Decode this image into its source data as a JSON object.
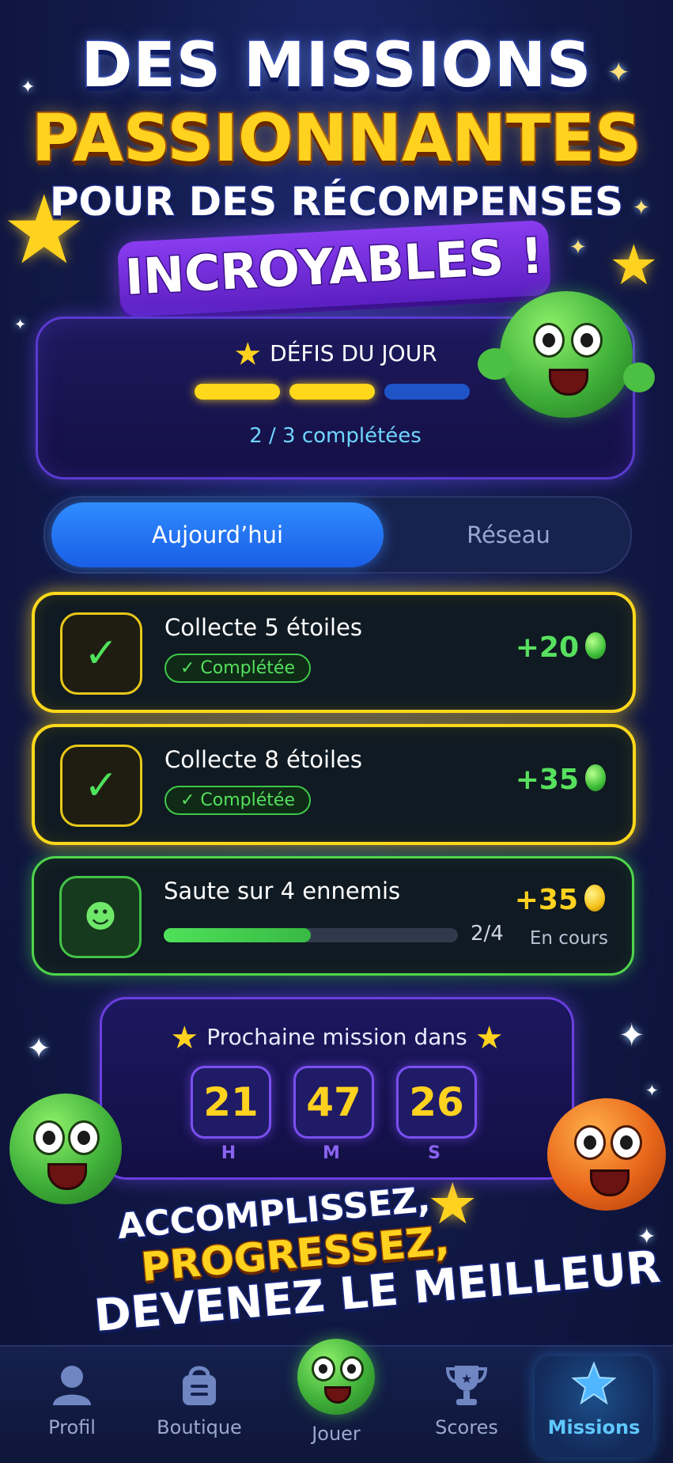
{
  "hero": {
    "line1": "DES MISSIONS",
    "line2": "PASSIONNANTES",
    "line3": "POUR DES RÉCOMPENSES",
    "line4": "INCROYABLES !"
  },
  "daily": {
    "title": "DÉFIS DU JOUR",
    "completed": 2,
    "total": 3,
    "count_label": "2 / 3 complétées"
  },
  "tabs": [
    {
      "label": "Aujourd’hui",
      "active": true
    },
    {
      "label": "Réseau",
      "active": false
    }
  ],
  "missions": [
    {
      "title": "Collecte 5 étoiles",
      "badge": "✓ Complétée",
      "reward": "+20",
      "status": "completed"
    },
    {
      "title": "Collecte 8 étoiles",
      "badge": "✓ Complétée",
      "reward": "+35",
      "status": "completed"
    },
    {
      "title": "Saute sur 4 ennemis",
      "progress_label": "2/4",
      "progress": 0.5,
      "reward": "+35",
      "status_text": "En cours"
    }
  ],
  "countdown": {
    "title": "Prochaine mission dans",
    "hours": "21",
    "minutes": "47",
    "seconds": "26",
    "h_label": "H",
    "m_label": "M",
    "s_label": "S"
  },
  "slogan": {
    "line1": "ACCOMPLISSEZ,",
    "line2": "PROGRESSEZ,",
    "line3": "DEVENEZ LE MEILLEUR !"
  },
  "nav": [
    {
      "label": "Profil",
      "icon": "profile-icon"
    },
    {
      "label": "Boutique",
      "icon": "shop-bag-icon"
    },
    {
      "label": "Jouer",
      "icon": "play-mascot-icon"
    },
    {
      "label": "Scores",
      "icon": "trophy-icon"
    },
    {
      "label": "Missions",
      "icon": "star-icon",
      "active": true
    }
  ],
  "colors": {
    "accent_yellow": "#ffd21f",
    "accent_green": "#4fe15a",
    "accent_blue": "#2f8cff",
    "accent_purple": "#6a3fe0",
    "background": "#121a4a"
  }
}
